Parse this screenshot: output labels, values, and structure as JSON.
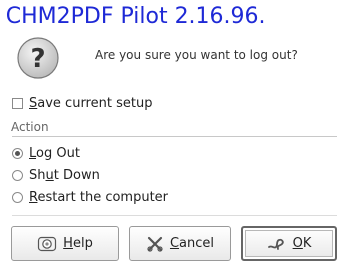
{
  "watermark": "f CHM2PDF Pilot 2.16.96.",
  "dialog": {
    "question": "Are you sure you want to log out?",
    "save_setup": {
      "mnemonic": "S",
      "rest": "ave current setup",
      "checked": false
    },
    "action_group": {
      "title": "Action",
      "options": [
        {
          "pre": "",
          "mnemonic": "L",
          "post": "og Out",
          "checked": true
        },
        {
          "pre": "Sh",
          "mnemonic": "u",
          "post": "t Down",
          "checked": false
        },
        {
          "pre": "",
          "mnemonic": "R",
          "post": "estart the computer",
          "checked": false
        }
      ]
    },
    "buttons": {
      "help": {
        "mnemonic": "H",
        "rest": "elp",
        "icon": "help-icon"
      },
      "cancel": {
        "mnemonic": "C",
        "rest": "ancel",
        "icon": "cancel-icon"
      },
      "ok": {
        "mnemonic": "O",
        "rest": "K",
        "icon": "ok-icon"
      }
    }
  }
}
